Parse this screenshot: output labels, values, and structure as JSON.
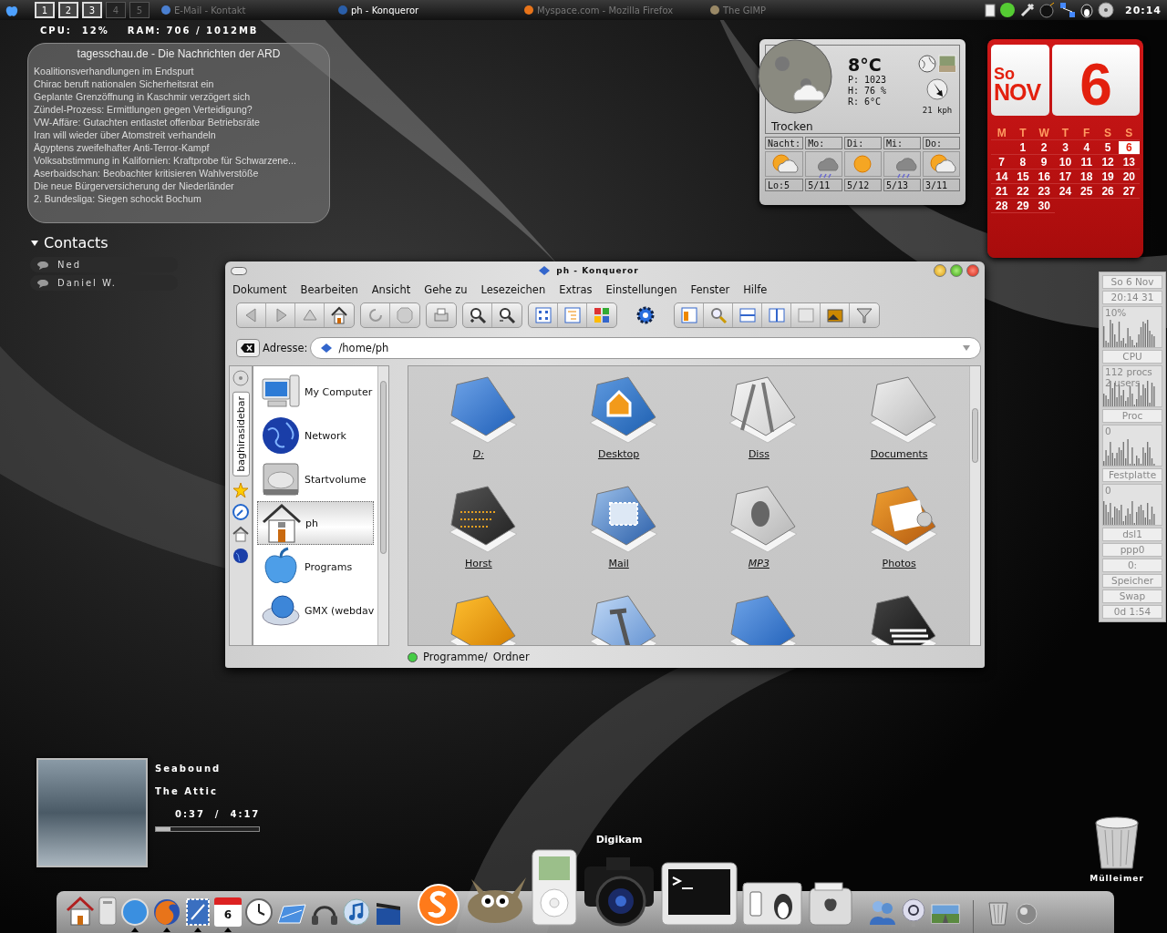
{
  "top_bar": {
    "desktops": [
      {
        "label": "1",
        "active": true
      },
      {
        "label": "2",
        "active": true
      },
      {
        "label": "3",
        "active": true
      },
      {
        "label": "4",
        "active": false
      },
      {
        "label": "5",
        "active": false
      }
    ],
    "tasks": [
      {
        "label": "E-Mail - Kontakt",
        "kind": "mail",
        "minimized": true
      },
      {
        "label": "ph - Konqueror",
        "kind": "konqueror",
        "minimized": false
      },
      {
        "label": "Myspace.com - Mozilla Firefox",
        "kind": "firefox",
        "minimized": true
      },
      {
        "label": "The GIMP",
        "kind": "gimp",
        "minimized": true
      }
    ],
    "clock": "20:14"
  },
  "system_line": {
    "cpu": "CPU:  12%",
    "ram": "RAM: 706 / 1012MB"
  },
  "news": {
    "title": "tagesschau.de - Die Nachrichten der ARD",
    "items": [
      "Koalitionsverhandlungen im Endspurt",
      "Chirac beruft nationalen Sicherheitsrat ein",
      "Geplante Grenzöffnung in Kaschmir verzögert sich",
      "Zündel-Prozess: Ermittlungen gegen Verteidigung?",
      "VW-Affäre: Gutachten entlastet offenbar Betriebsräte",
      "Iran will wieder über Atomstreit verhandeln",
      "Ägyptens zweifelhafter Anti-Terror-Kampf",
      "Volksabstimmung in Kalifornien: Kraftprobe für Schwarzene...",
      "Aserbaidschan: Beobachter kritisieren Wahlverstöße",
      "Die neue Bürgerversicherung der Niederländer",
      "2. Bundesliga: Siegen schockt Bochum"
    ]
  },
  "contacts": {
    "title": "Contacts",
    "expanded": true,
    "items": [
      "Ned",
      "Daniel W."
    ]
  },
  "weather": {
    "temperature": "8°C",
    "pressure": "P: 1023",
    "humidity": "H: 76 %",
    "feels_like": "R: 6°C",
    "wind": "21 kph",
    "condition": "Trocken",
    "forecast": [
      {
        "day": "Nacht:",
        "temp": "Lo:5",
        "kind": "partly-sunny"
      },
      {
        "day": "Mo:",
        "temp": "5/11",
        "kind": "rain"
      },
      {
        "day": "Di:",
        "temp": "5/12",
        "kind": "sunny"
      },
      {
        "day": "Mi:",
        "temp": "5/13",
        "kind": "rain"
      },
      {
        "day": "Do:",
        "temp": "3/11",
        "kind": "partly-sunny"
      }
    ]
  },
  "calendar": {
    "weekday": "So",
    "month": "NOV",
    "day": "6",
    "headers": [
      "M",
      "T",
      "W",
      "T",
      "F",
      "S",
      "S"
    ],
    "days": [
      {
        "day": "1",
        "selected": false
      },
      {
        "day": "2",
        "selected": false
      },
      {
        "day": "3",
        "selected": false
      },
      {
        "day": "4",
        "selected": false
      },
      {
        "day": "5",
        "selected": false
      },
      {
        "day": "6",
        "selected": true
      },
      {
        "day": "7",
        "selected": false
      },
      {
        "day": "8",
        "selected": false
      },
      {
        "day": "9",
        "selected": false
      },
      {
        "day": "10",
        "selected": false
      },
      {
        "day": "11",
        "selected": false
      },
      {
        "day": "12",
        "selected": false
      },
      {
        "day": "13",
        "selected": false
      },
      {
        "day": "14",
        "selected": false
      },
      {
        "day": "15",
        "selected": false
      },
      {
        "day": "16",
        "selected": false
      },
      {
        "day": "17",
        "selected": false
      },
      {
        "day": "18",
        "selected": false
      },
      {
        "day": "19",
        "selected": false
      },
      {
        "day": "20",
        "selected": false
      },
      {
        "day": "21",
        "selected": false
      },
      {
        "day": "22",
        "selected": false
      },
      {
        "day": "23",
        "selected": false
      },
      {
        "day": "24",
        "selected": false
      },
      {
        "day": "25",
        "selected": false
      },
      {
        "day": "26",
        "selected": false
      },
      {
        "day": "27",
        "selected": false
      },
      {
        "day": "28",
        "selected": false
      },
      {
        "day": "29",
        "selected": false
      },
      {
        "day": "30",
        "selected": false
      }
    ]
  },
  "konqueror": {
    "title": "ph - Konqueror",
    "menu": [
      "Dokument",
      "Bearbeiten",
      "Ansicht",
      "Gehe zu",
      "Lesezeichen",
      "Extras",
      "Einstellungen",
      "Fenster",
      "Hilfe"
    ],
    "address_label": "Adresse:",
    "address": "/home/ph",
    "sidebar_tab": "baghirasidebar",
    "places": [
      {
        "label": "My Computer",
        "kind": "computer",
        "selected": false
      },
      {
        "label": "Network",
        "kind": "globe",
        "selected": false
      },
      {
        "label": "Startvolume",
        "kind": "disk",
        "selected": false
      },
      {
        "label": "ph",
        "kind": "home",
        "selected": true
      },
      {
        "label": "Programs",
        "kind": "apple",
        "selected": false
      },
      {
        "label": "GMX (webdav",
        "kind": "webdav",
        "selected": false
      }
    ],
    "files": [
      {
        "name": "D:",
        "kind": "blue",
        "link": true
      },
      {
        "name": "Desktop",
        "kind": "house",
        "link": false
      },
      {
        "name": "Diss",
        "kind": "tools",
        "link": false
      },
      {
        "name": "Documents",
        "kind": "plain",
        "link": false
      },
      {
        "name": "Horst",
        "kind": "display",
        "link": false
      },
      {
        "name": "Mail",
        "kind": "mail",
        "link": false
      },
      {
        "name": "MP3",
        "kind": "speaker",
        "link": true
      },
      {
        "name": "Photos",
        "kind": "photo",
        "link": false
      },
      {
        "kind": "orange"
      },
      {
        "kind": "hammer"
      },
      {
        "kind": "blue"
      },
      {
        "kind": "piano"
      }
    ],
    "status": [
      "Programme/",
      "Ordner"
    ]
  },
  "sysmon": {
    "date": "So 6 Nov",
    "time": "20:14 31",
    "graphs": [
      {
        "lines": [
          "10%"
        ],
        "caption": "CPU"
      },
      {
        "lines": [
          "112 procs",
          "2 users"
        ],
        "caption": "Proc"
      },
      {
        "lines": [
          "0"
        ],
        "caption": "Festplatte"
      },
      {
        "lines": [
          "0"
        ]
      }
    ],
    "meters": [
      "dsl1",
      "ppp0",
      "0:",
      "Speicher",
      "Swap"
    ],
    "uptime": "0d 1:54"
  },
  "player": {
    "artist": "Seabound",
    "album": "The Attic",
    "time": "0:37  /  4:17",
    "level": 0.14
  },
  "dock": {
    "items": [
      {
        "kind": "home",
        "running": false
      },
      {
        "kind": "computer",
        "running": false
      },
      {
        "kind": "compass",
        "running": true
      },
      {
        "kind": "firefox",
        "running": true
      },
      {
        "kind": "mail",
        "running": true
      },
      {
        "kind": "calendar",
        "running": true,
        "label": "6"
      },
      {
        "kind": "clock",
        "running": false
      },
      {
        "kind": "network",
        "running": false
      },
      {
        "kind": "headphones",
        "running": false
      },
      {
        "kind": "music",
        "running": false
      },
      {
        "kind": "clapper",
        "running": false
      },
      {
        "kind": "skype",
        "running": false
      },
      {
        "kind": "gimp",
        "running": false
      },
      {
        "kind": "ipod",
        "running": false
      },
      {
        "kind": "camera",
        "running": false,
        "tooltip": "Digikam"
      },
      {
        "kind": "terminal",
        "running": false
      },
      {
        "kind": "switch",
        "running": false
      },
      {
        "kind": "toaster",
        "running": false
      },
      {
        "kind": "people",
        "running": false
      },
      {
        "kind": "at",
        "running": false
      },
      {
        "kind": "road",
        "running": false
      },
      {
        "kind": "trash",
        "running": false
      },
      {
        "kind": "sphere",
        "running": false
      }
    ]
  },
  "trash": {
    "label": "Mülleimer"
  }
}
